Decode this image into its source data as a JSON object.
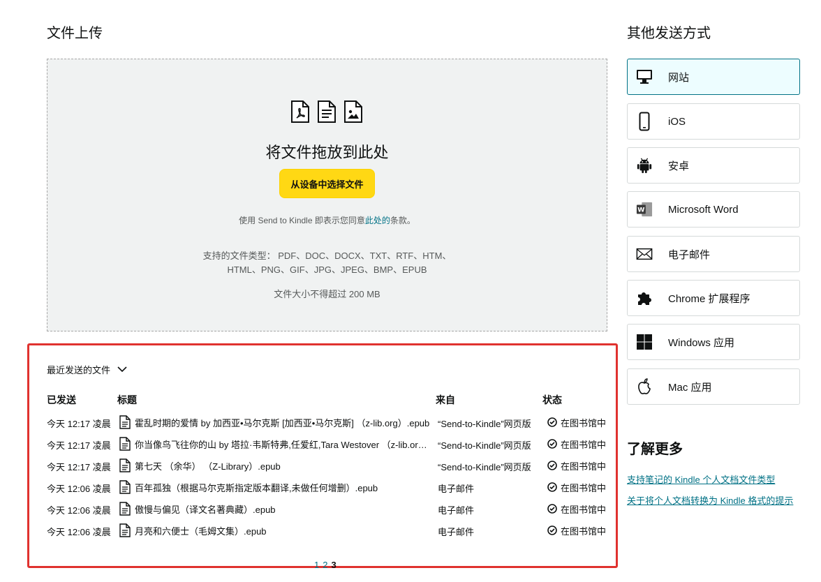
{
  "upload": {
    "title": "文件上传",
    "drop_heading": "将文件拖放到此处",
    "choose_button": "从设备中选择文件",
    "agree_prefix": "使用 Send to Kindle 即表示您同意",
    "agree_link": "此处的",
    "agree_suffix": "条款。",
    "types_line1": "支持的文件类型： PDF、DOC、DOCX、TXT、RTF、HTM、",
    "types_line2": "HTML、PNG、GIF、JPG、JPEG、BMP、EPUB",
    "size_limit": "文件大小不得超过 200 MB"
  },
  "recent": {
    "toggle_label": "最近发送的文件",
    "headers": {
      "sent": "已发送",
      "title": "标题",
      "from": "来自",
      "status": "状态"
    },
    "rows": [
      {
        "sent": "今天 12:17 凌晨",
        "title": "霍乱时期的爱情 by 加西亚•马尔克斯 [加西亚•马尔克斯] （z-lib.org）.epub",
        "from": "“Send-to-Kindle”网页版",
        "status": "在图书馆中"
      },
      {
        "sent": "今天 12:17 凌晨",
        "title": "你当像鸟飞往你的山 by 塔拉·韦斯特弗,任爱红,Tara Westover （z-lib.org）.epub",
        "from": "“Send-to-Kindle”网页版",
        "status": "在图书馆中"
      },
      {
        "sent": "今天 12:17 凌晨",
        "title": "第七天 （余华） （Z-Library）.epub",
        "from": "“Send-to-Kindle”网页版",
        "status": "在图书馆中"
      },
      {
        "sent": "今天 12:06 凌晨",
        "title": "百年孤独（根据马尔克斯指定版本翻译,未做任何增删）.epub",
        "from": "电子邮件",
        "status": "在图书馆中"
      },
      {
        "sent": "今天 12:06 凌晨",
        "title": "傲慢与偏见（译文名著典藏）.epub",
        "from": "电子邮件",
        "status": "在图书馆中"
      },
      {
        "sent": "今天 12:06 凌晨",
        "title": "月亮和六便士（毛姆文集）.epub",
        "from": "电子邮件",
        "status": "在图书馆中"
      }
    ],
    "pages": [
      "1",
      "2",
      "3"
    ]
  },
  "other": {
    "title": "其他发送方式",
    "methods": [
      {
        "label": "网站",
        "icon": "monitor-icon"
      },
      {
        "label": "iOS",
        "icon": "phone-icon"
      },
      {
        "label": "安卓",
        "icon": "android-icon"
      },
      {
        "label": "Microsoft Word",
        "icon": "word-icon"
      },
      {
        "label": "电子邮件",
        "icon": "envelope-icon"
      },
      {
        "label": "Chrome 扩展程序",
        "icon": "puzzle-icon"
      },
      {
        "label": "Windows 应用",
        "icon": "windows-icon"
      },
      {
        "label": "Mac 应用",
        "icon": "apple-icon"
      }
    ]
  },
  "learn": {
    "title": "了解更多",
    "link1": "支持笔记的 Kindle 个人文档文件类型",
    "link2": "关于将个人文档转换为 Kindle 格式的提示"
  },
  "colors": {
    "accent_button": "#ffd814",
    "link": "#007185",
    "highlight_box": "#e0322f",
    "active_method_bg": "#edfdff"
  }
}
